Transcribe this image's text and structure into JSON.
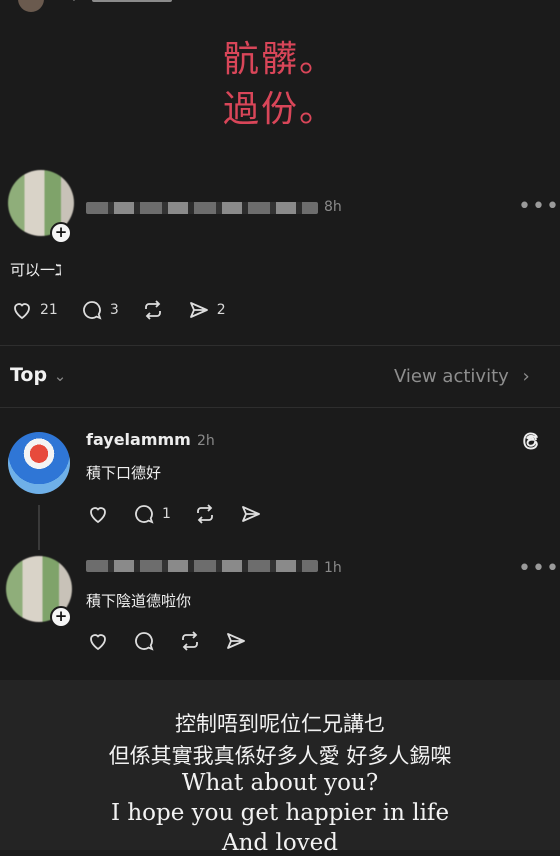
{
  "top_header": {
    "partial_title": ""
  },
  "overlay": {
    "line1": "骯髒。",
    "line2": "過份。"
  },
  "post": {
    "time": "8h",
    "text": "可以一ℷ",
    "likes": "21",
    "replies": "3",
    "shares": "2"
  },
  "sort_bar": {
    "label": "Top",
    "view_activity": "View activity"
  },
  "comments": [
    {
      "username": "fayelammm",
      "time": "2h",
      "text": "積下口德好",
      "replies": "1"
    },
    {
      "username": "",
      "time": "1h",
      "text": "積下陰道德啦你"
    }
  ],
  "captions": {
    "line1": "控制唔到呢位仁兄講乜",
    "line2": "但係其實我真係好多人愛 好多人錫㗎",
    "line3": "What about you?",
    "line4": "I hope you get happier in life",
    "line5": "And loved"
  },
  "icons": [
    "heart-icon",
    "comment-icon",
    "repost-icon",
    "share-icon",
    "more-icon",
    "threads-icon",
    "chevron-down-icon",
    "chevron-right-icon",
    "plus-icon"
  ]
}
